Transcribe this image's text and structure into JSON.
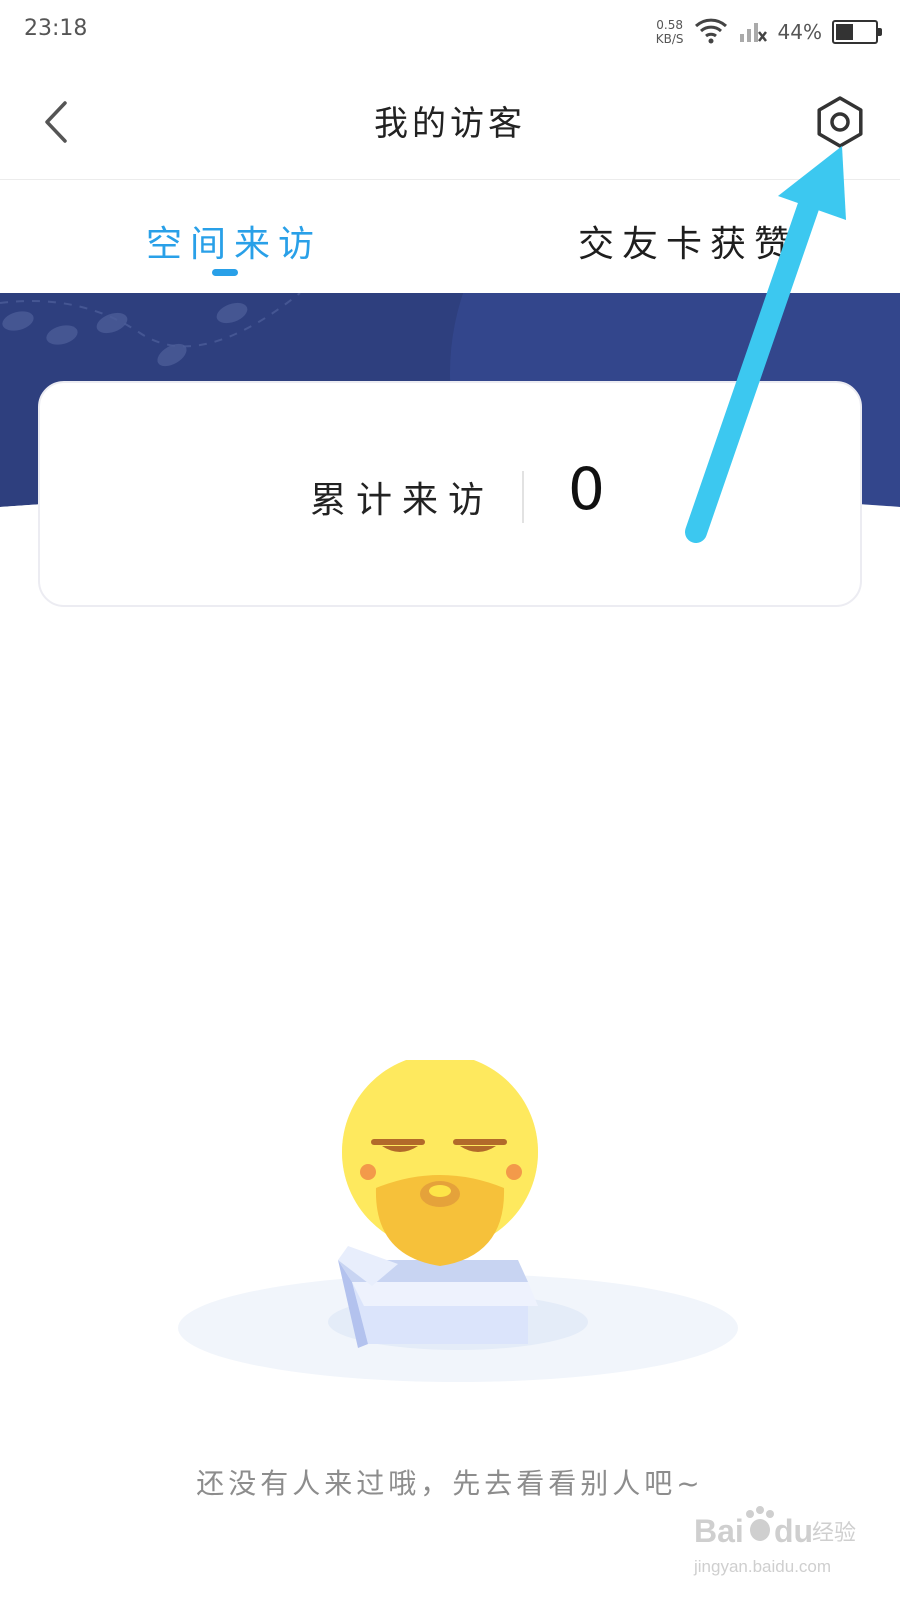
{
  "status_bar": {
    "time": "23:18",
    "net_speed_value": "0.58",
    "net_speed_unit": "KB/S",
    "battery_percent": "44%",
    "battery_level": 0.44
  },
  "nav": {
    "title": "我的访客"
  },
  "tabs": [
    {
      "label": "空间来访",
      "active": true
    },
    {
      "label": "交友卡获赞",
      "active": false
    }
  ],
  "summary": {
    "label": "累计来访",
    "value": "0"
  },
  "empty_state": {
    "message": "还没有人来过哦，先去看看别人吧~"
  },
  "watermark": {
    "brand": "Bai",
    "brand_suffix": "du",
    "product": "经验",
    "url": "jingyan.baidu.com"
  },
  "colors": {
    "accent": "#29a0e8",
    "hero_bg": "#2e3f7e",
    "annotation_arrow": "#3cc8f0"
  },
  "icons": {
    "back": "chevron-left-icon",
    "settings": "gear-icon"
  }
}
